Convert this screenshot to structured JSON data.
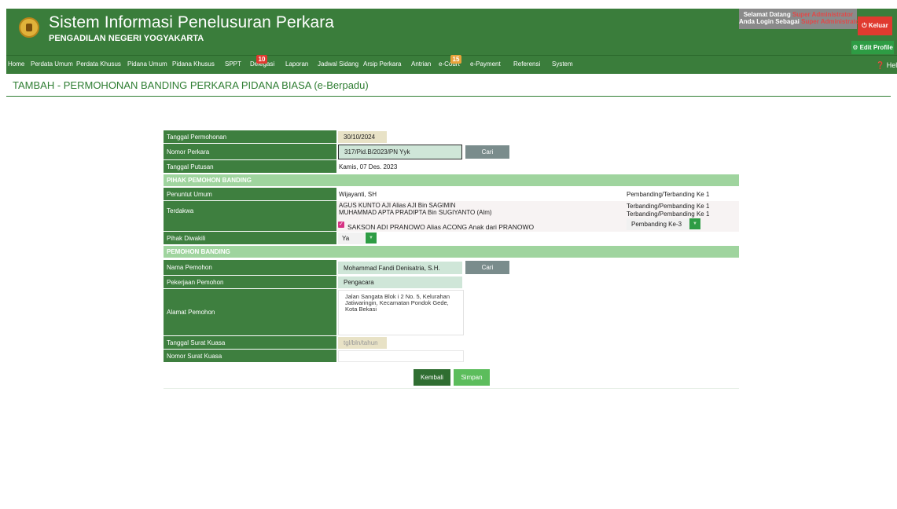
{
  "header": {
    "title": "Sistem Informasi Penelusuran Perkara",
    "subtitle": "PENGADILAN NEGERI YOGYAKARTA",
    "welcome_line1": "Selamat Datang",
    "welcome_user": "Super Administrator",
    "welcome_line2": "Anda Login Sebagai",
    "welcome_role": "Super Administrator",
    "logout_label": "⏻ Keluar",
    "edit_profile_label": "⚙ Edit Profile"
  },
  "nav": {
    "items": [
      "Home",
      "Perdata Umum",
      "Perdata Khusus",
      "Pidana Umum",
      "Pidana Khusus",
      "SPPT",
      "Delegasi",
      "Laporan",
      "Jadwal Sidang",
      "Arsip Perkara",
      "Antrian",
      "e-Court",
      "e-Payment",
      "Referensi",
      "System"
    ],
    "delegasi_badge": "10",
    "ecourt_badge": "15",
    "help_label": "❓ Help",
    "badge_colors": {
      "delegasi": "#e03a2f",
      "ecourt": "#e8a23a"
    }
  },
  "page": {
    "title": "TAMBAH - PERMOHONAN BANDING PERKARA PIDANA BIASA (e-Berpadu)"
  },
  "form": {
    "tanggal_permohonan_label": "Tanggal Permohonan",
    "tanggal_permohonan_value": "30/10/2024",
    "nomor_perkara_label": "Nomor Perkara",
    "nomor_perkara_value": "317/Pid.B/2023/PN Yyk",
    "cari_label": "Cari",
    "tanggal_putusan_label": "Tanggal Putusan",
    "tanggal_putusan_value": "Kamis, 07 Des. 2023",
    "section_pihak": "PIHAK PEMOHON BANDING",
    "penuntut_umum_label": "Penuntut Umum",
    "penuntut_umum_value": "Wijayanti, SH",
    "penuntut_umum_role": "Pembanding/Terbanding Ke 1",
    "terdakwa_label": "Terdakwa",
    "terdakwa_1": "AGUS KUNTO AJI Alias AJI Bin SAGIMIN",
    "terdakwa_1_role": "Terbanding/Pembanding Ke 1",
    "terdakwa_2": "MUHAMMAD APTA PRADIPTA Bin SUGIYANTO (Alm)",
    "terdakwa_2_role": "Terbanding/Pembanding Ke 1",
    "terdakwa_3": "SAKSON ADI PRANOWO Alias ACONG Anak dari PRANOWO",
    "terdakwa_3_select": "Pembanding Ke-3",
    "pihak_diwakili_label": "Pihak Diwakili",
    "pihak_diwakili_value": "Ya",
    "section_pemohon": "PEMOHON BANDING",
    "nama_pemohon_label": "Nama Pemohon",
    "nama_pemohon_value": "Mohammad Fandi Denisatria, S.H.",
    "pekerjaan_label": "Pekerjaan Pemohon",
    "pekerjaan_value": "Pengacara",
    "alamat_label": "Alamat Pemohon",
    "alamat_line1": "Jalan Sangata Blok i 2 No. 5, Kelurahan",
    "alamat_line2": "Jatiwaringin, Kecamatan Pondok Gede,",
    "alamat_line3": "Kota Bekasi",
    "tanggal_surat_kuasa_label": "Tanggal Surat Kuasa",
    "tanggal_surat_kuasa_placeholder": "tgl/bln/tahun",
    "nomor_surat_kuasa_label": "Nomor Surat Kuasa",
    "nomor_surat_kuasa_value": "",
    "kembali_label": "Kembali",
    "simpan_label": "Simpan"
  }
}
